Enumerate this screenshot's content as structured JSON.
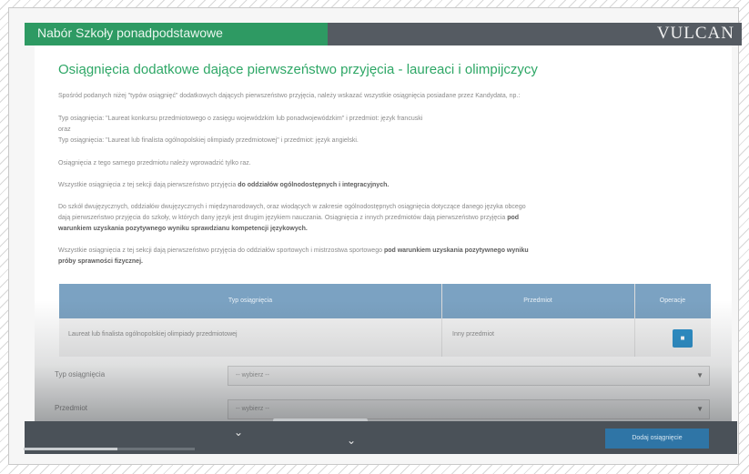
{
  "header": {
    "title": "Nabór Szkoły ponadpodstawowe",
    "logo": "VULCAN"
  },
  "section": {
    "title": "Osiągnięcia dodatkowe dające pierwszeństwo przyjęcia - laureaci i olimpijczycy",
    "p1": "Spośród podanych niżej \"typów osiągnięć\" dodatkowych dających pierwszeństwo przyjęcia, należy wskazać wszystkie osiągnięcia posiadane przez Kandydata, np.:",
    "p2": "Typ osiągnięcia: \"Laureat konkursu przedmiotowego o zasięgu wojewódzkim lub ponadwojewódzkim\" i przedmiot: język francuski",
    "p3": "oraz",
    "p4": "Typ osiągnięcia: \"Laureat lub finalista ogólnopolskiej olimpiady przedmiotowej\" i przedmiot: język angielski.",
    "p5": "Osiągnięcia z tego samego przedmiotu należy wprowadzić tylko raz.",
    "p6_text": "Wszystkie osiągnięcia z tej sekcji dają pierwszeństwo przyjęcia",
    "p6_bold": "do oddziałów ogólnodostępnych i integracyjnych.",
    "p7_line1": "Do szkół dwujęzycznych, oddziałów dwujęzycznych i międzynarodowych, oraz wiodących w zakresie ogólnodostępnych osiągnięcia dotyczące danego języka obcego",
    "p7_line2_text": "dają pierwszeństwo przyjęcia do szkoły, w których dany język jest drugim językiem nauczania. Osiągnięcia z innych przedmiotów dają pierwszeństwo przyjęcia",
    "p7_line2_bold": "pod",
    "p7_line3_bold": "warunkiem uzyskania pozytywnego wyniku sprawdzianu kompetencji językowych.",
    "p8_line1_text": "Wszystkie osiągnięcia z tej sekcji dają pierwszeństwo przyjęcia do oddziałów sportowych i mistrzostwa sportowego",
    "p8_line1_bold": "pod warunkiem uzyskania pozytywnego wyniku",
    "p8_line2_bold": "próby sprawności fizycznej."
  },
  "table": {
    "headers": [
      "Typ osiągnięcia",
      "Przedmiot",
      "Operacje"
    ],
    "rows": [
      {
        "type": "Laureat lub finalista ogólnopolskiej olimpiady przedmiotowej",
        "subject": "Inny przedmiot",
        "action_icon": "trash-icon"
      }
    ]
  },
  "form": {
    "type_label": "Typ osiągnięcia",
    "type_value": "-- wybierz --",
    "subject_label": "Przedmiot",
    "subject_value": "-- wybierz --"
  },
  "footer": {
    "add_button": "Dodaj osiągnięcie",
    "progress": 0.55
  },
  "colors": {
    "brand_green": "#2e9a63",
    "header_dark": "#555b62",
    "table_header": "#7ba2c2",
    "button_blue": "#2f75a6"
  }
}
